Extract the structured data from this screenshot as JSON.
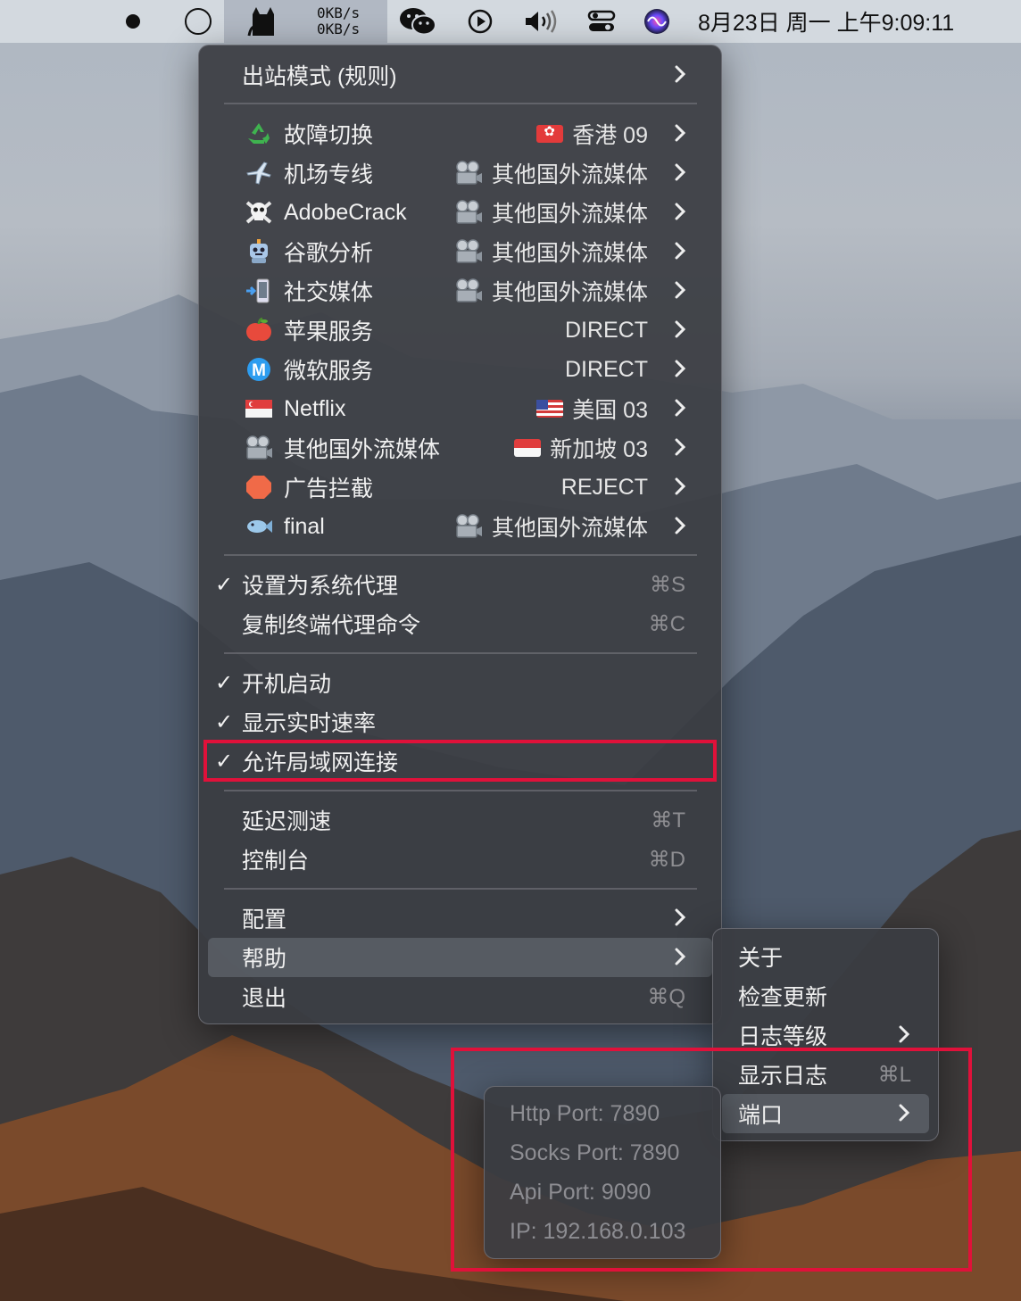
{
  "menubar": {
    "speed_up": "0KB/s",
    "speed_down": "0KB/s",
    "clock": "8月23日 周一 上午9:09:11"
  },
  "main_menu": {
    "outbound_mode": "出站模式 (规则)",
    "groups": [
      {
        "icon": "recycle-icon",
        "name": "故障切换",
        "value": "香港 09",
        "flag": "hk"
      },
      {
        "icon": "airplane-icon",
        "name": "机场专线",
        "value": "其他国外流媒体",
        "flag": "media"
      },
      {
        "icon": "skull-icon",
        "name": "AdobeCrack",
        "value": "其他国外流媒体",
        "flag": "media"
      },
      {
        "icon": "robot-icon",
        "name": "谷歌分析",
        "value": "其他国外流媒体",
        "flag": "media"
      },
      {
        "icon": "phone-icon",
        "name": "社交媒体",
        "value": "其他国外流媒体",
        "flag": "media"
      },
      {
        "icon": "apple-icon",
        "name": "苹果服务",
        "value": "DIRECT",
        "flag": ""
      },
      {
        "icon": "m-icon",
        "name": "微软服务",
        "value": "DIRECT",
        "flag": ""
      },
      {
        "icon": "sg-flag-icon",
        "name": "Netflix",
        "value": "美国 03",
        "flag": "us"
      },
      {
        "icon": "projector-icon",
        "name": "其他国外流媒体",
        "value": "新加坡 03",
        "flag": "sg"
      },
      {
        "icon": "stop-sign-icon",
        "name": "广告拦截",
        "value": "REJECT",
        "flag": ""
      },
      {
        "icon": "fish-icon",
        "name": "final",
        "value": "其他国外流媒体",
        "flag": "media"
      }
    ],
    "set_system_proxy": "设置为系统代理",
    "set_system_proxy_shortcut": "⌘S",
    "copy_terminal_cmd": "复制终端代理命令",
    "copy_terminal_cmd_shortcut": "⌘C",
    "launch_at_login": "开机启动",
    "show_speed": "显示实时速率",
    "allow_lan": "允许局域网连接",
    "latency_test": "延迟测速",
    "latency_test_shortcut": "⌘T",
    "dashboard": "控制台",
    "dashboard_shortcut": "⌘D",
    "config": "配置",
    "help": "帮助",
    "quit": "退出",
    "quit_shortcut": "⌘Q"
  },
  "help_menu": {
    "about": "关于",
    "check_update": "检查更新",
    "log_level": "日志等级",
    "show_log": "显示日志",
    "show_log_shortcut": "⌘L",
    "ports": "端口"
  },
  "port_menu": {
    "http": "Http Port: 7890",
    "socks": "Socks Port: 7890",
    "api": "Api Port: 9090",
    "ip": "IP: 192.168.0.103"
  },
  "colors": {
    "highlight_box": "#e0113a",
    "menu_bg": "#3a3c42"
  }
}
